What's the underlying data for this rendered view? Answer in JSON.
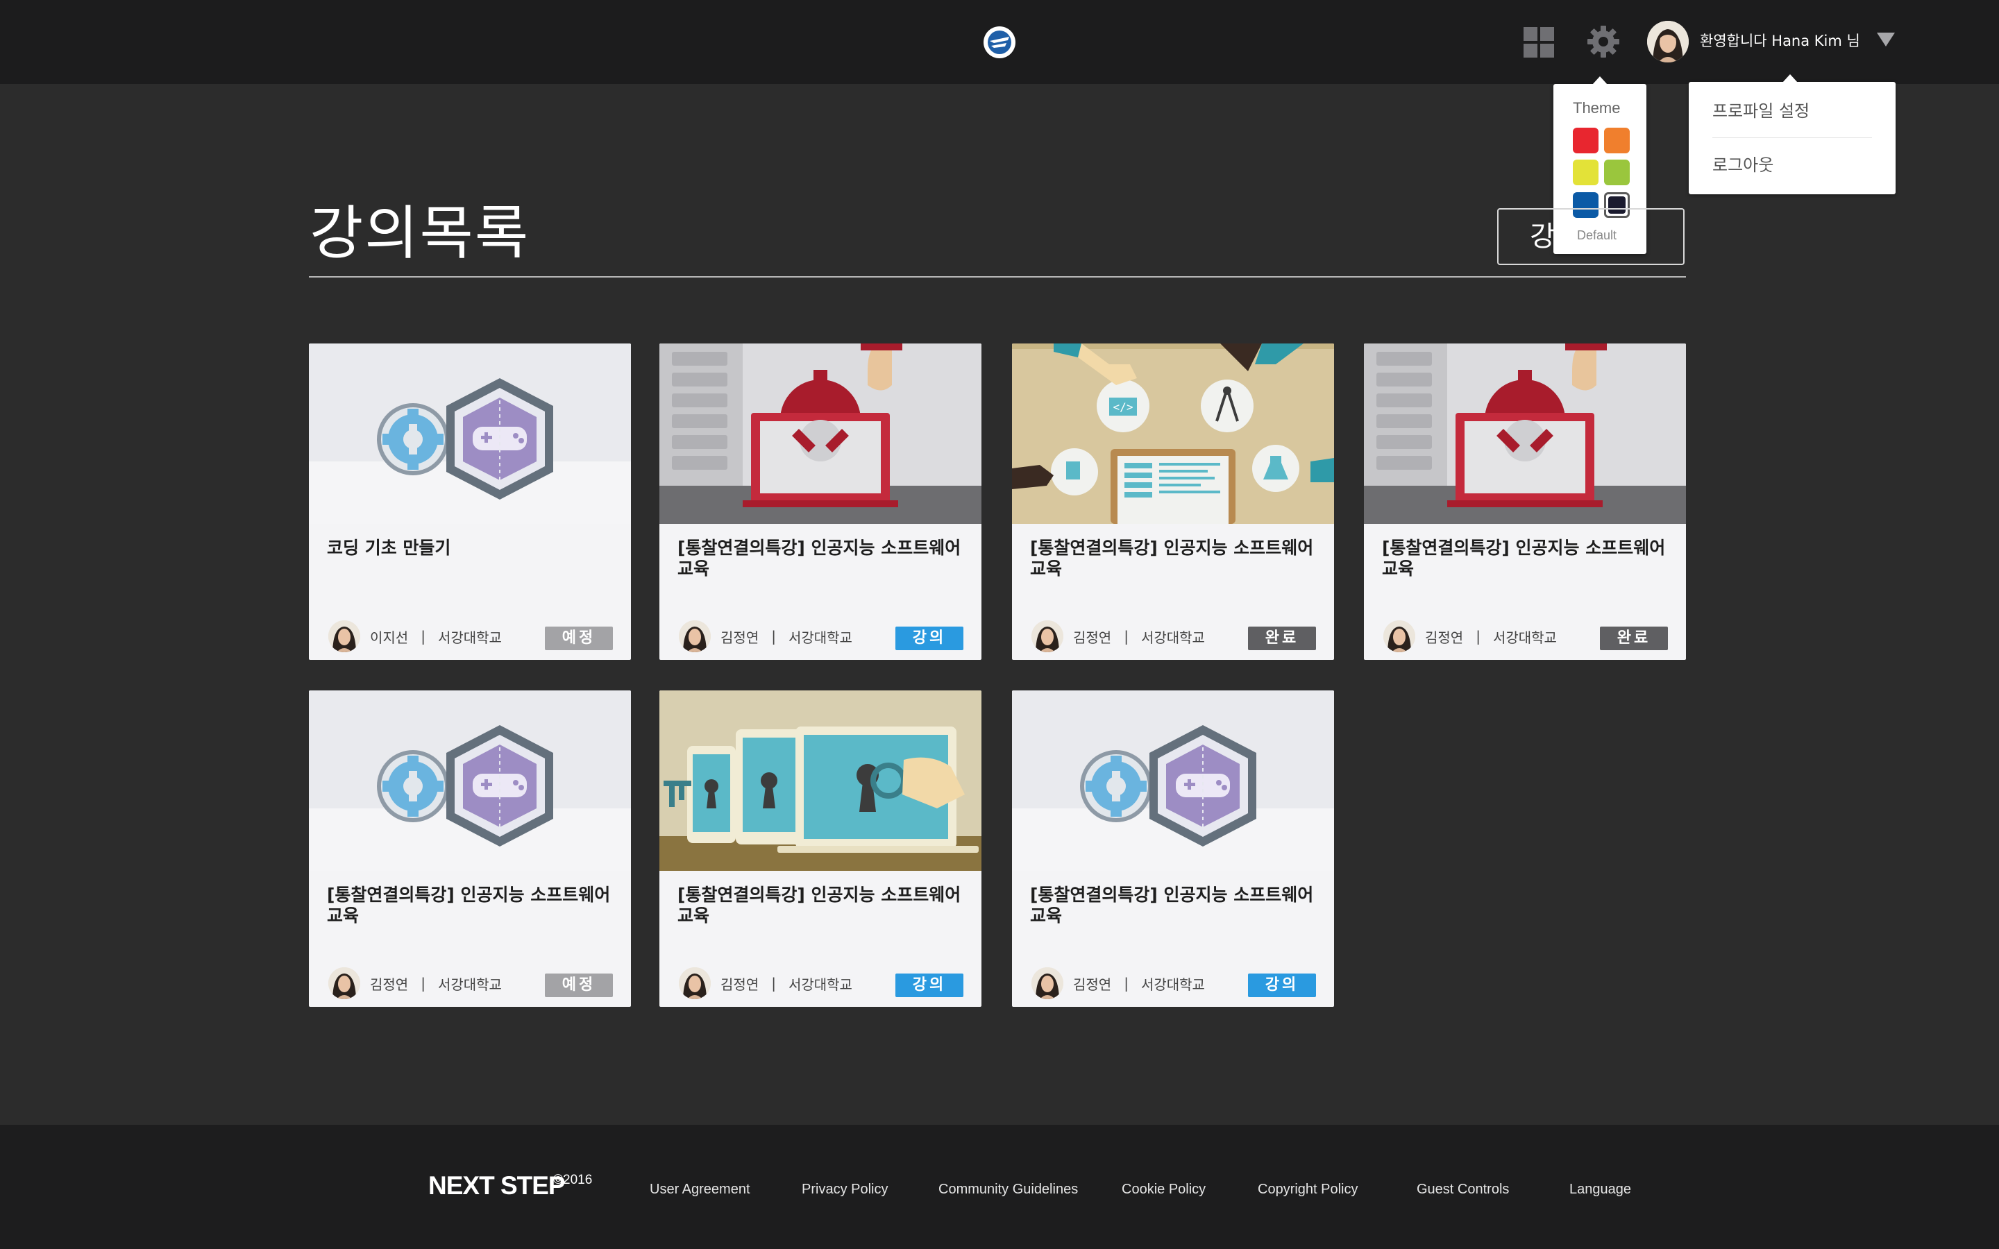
{
  "header": {
    "welcome": "환영합니다 Hana Kim 님",
    "logo_icon": "app-logo-icon",
    "apps_icon": "grid-icon",
    "settings_icon": "gear-icon",
    "menu_icon": "dropdown-arrow-icon"
  },
  "theme_popup": {
    "title": "Theme",
    "default_label": "Default",
    "swatches": [
      {
        "name": "red",
        "color": "#e8262f"
      },
      {
        "name": "orange",
        "color": "#f07f2d"
      },
      {
        "name": "yellow",
        "color": "#e3e238"
      },
      {
        "name": "green",
        "color": "#9ac63d"
      },
      {
        "name": "blue",
        "color": "#0b5aa6"
      },
      {
        "name": "dark",
        "color": "#1a1a2e",
        "selected": true
      }
    ]
  },
  "profile_menu": {
    "items": [
      "프로파일 설정",
      "로그아웃"
    ]
  },
  "page": {
    "title": "강의목록",
    "create_button_label": "강"
  },
  "courses": [
    {
      "title": "코딩 기초 만들기",
      "instructor": "이지선",
      "school": "서강대학교",
      "status": "예정",
      "status_type": "scheduled",
      "thumbnail": "gear-gamepad"
    },
    {
      "title": "[통찰연결의특강] 인공지능 소프트웨어 교육",
      "instructor": "김정연",
      "school": "서강대학교",
      "status": "강의",
      "status_type": "lecture",
      "thumbnail": "gear-laptop"
    },
    {
      "title": "[통찰연결의특강] 인공지능 소프트웨어 교육",
      "instructor": "김정연",
      "school": "서강대학교",
      "status": "완료",
      "status_type": "done",
      "thumbnail": "coding-tools"
    },
    {
      "title": "[통찰연결의특강] 인공지능 소프트웨어 교육",
      "instructor": "김정연",
      "school": "서강대학교",
      "status": "완료",
      "status_type": "done",
      "thumbnail": "gear-laptop"
    },
    {
      "title": "[통찰연결의특강] 인공지능 소프트웨어 교육",
      "instructor": "김정연",
      "school": "서강대학교",
      "status": "예정",
      "status_type": "scheduled",
      "thumbnail": "gear-gamepad"
    },
    {
      "title": "[통찰연결의특강] 인공지능 소프트웨어 교육",
      "instructor": "김정연",
      "school": "서강대학교",
      "status": "강의",
      "status_type": "lecture",
      "thumbnail": "keyhole-devices"
    },
    {
      "title": "[통찰연결의특강] 인공지능 소프트웨어 교육",
      "instructor": "김정연",
      "school": "서강대학교",
      "status": "강의",
      "status_type": "lecture",
      "thumbnail": "gear-gamepad"
    }
  ],
  "footer": {
    "brand": "NEXT STEP",
    "copyright": "©2016",
    "links": [
      "User Agreement",
      "Privacy Policy",
      "Community Guidelines",
      "Cookie Policy",
      "Copyright Policy",
      "Guest Controls",
      "Language"
    ]
  }
}
